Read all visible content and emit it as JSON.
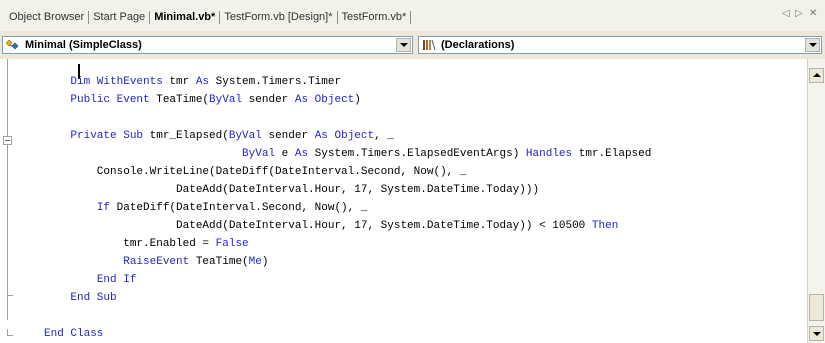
{
  "tabs": [
    {
      "label": "Object Browser",
      "active": false
    },
    {
      "label": "Start Page",
      "active": false
    },
    {
      "label": "Minimal.vb*",
      "active": true
    },
    {
      "label": "TestForm.vb [Design]*",
      "active": false
    },
    {
      "label": "TestForm.vb*",
      "active": false
    }
  ],
  "tab_nav": {
    "prev": "◁",
    "next": "▷",
    "close": "✕"
  },
  "dropdowns": {
    "class_selector": "Minimal (SimpleClass)",
    "member_selector": "(Declarations)"
  },
  "code_lines": [
    [
      {
        "t": "    "
      },
      {
        "t": "Dim WithEvents",
        "k": 1
      },
      {
        "t": " tmr "
      },
      {
        "t": "As",
        "k": 1
      },
      {
        "t": " System.Timers.Timer"
      }
    ],
    [
      {
        "t": "    "
      },
      {
        "t": "Public Event",
        "k": 1
      },
      {
        "t": " TeaTime("
      },
      {
        "t": "ByVal",
        "k": 1
      },
      {
        "t": " sender "
      },
      {
        "t": "As Object",
        "k": 1
      },
      {
        "t": ")"
      }
    ],
    [
      {
        "t": ""
      }
    ],
    [
      {
        "t": "    "
      },
      {
        "t": "Private Sub",
        "k": 1
      },
      {
        "t": " tmr_Elapsed("
      },
      {
        "t": "ByVal",
        "k": 1
      },
      {
        "t": " sender "
      },
      {
        "t": "As Object",
        "k": 1
      },
      {
        "t": ", _"
      }
    ],
    [
      {
        "t": "                              "
      },
      {
        "t": "ByVal",
        "k": 1
      },
      {
        "t": " e "
      },
      {
        "t": "As",
        "k": 1
      },
      {
        "t": " System.Timers.ElapsedEventArgs) "
      },
      {
        "t": "Handles",
        "k": 1
      },
      {
        "t": " tmr.Elapsed"
      }
    ],
    [
      {
        "t": "        Console.WriteLine(DateDiff(DateInterval.Second, Now(), _"
      }
    ],
    [
      {
        "t": "                    DateAdd(DateInterval.Hour, 17, System.DateTime.Today)))"
      }
    ],
    [
      {
        "t": "        "
      },
      {
        "t": "If",
        "k": 1
      },
      {
        "t": " DateDiff(DateInterval.Second, Now(), _"
      }
    ],
    [
      {
        "t": "                    DateAdd(DateInterval.Hour, 17, System.DateTime.Today)) < 10500 "
      },
      {
        "t": "Then",
        "k": 1
      }
    ],
    [
      {
        "t": "            tmr.Enabled = "
      },
      {
        "t": "False",
        "k": 1
      }
    ],
    [
      {
        "t": "            "
      },
      {
        "t": "RaiseEvent",
        "k": 1
      },
      {
        "t": " TeaTime("
      },
      {
        "t": "Me",
        "k": 1
      },
      {
        "t": ")"
      }
    ],
    [
      {
        "t": "        "
      },
      {
        "t": "End If",
        "k": 1
      }
    ],
    [
      {
        "t": "    "
      },
      {
        "t": "End Sub",
        "k": 1
      }
    ],
    [
      {
        "t": ""
      }
    ],
    [
      {
        "t": "End Class",
        "k": 1
      }
    ]
  ]
}
